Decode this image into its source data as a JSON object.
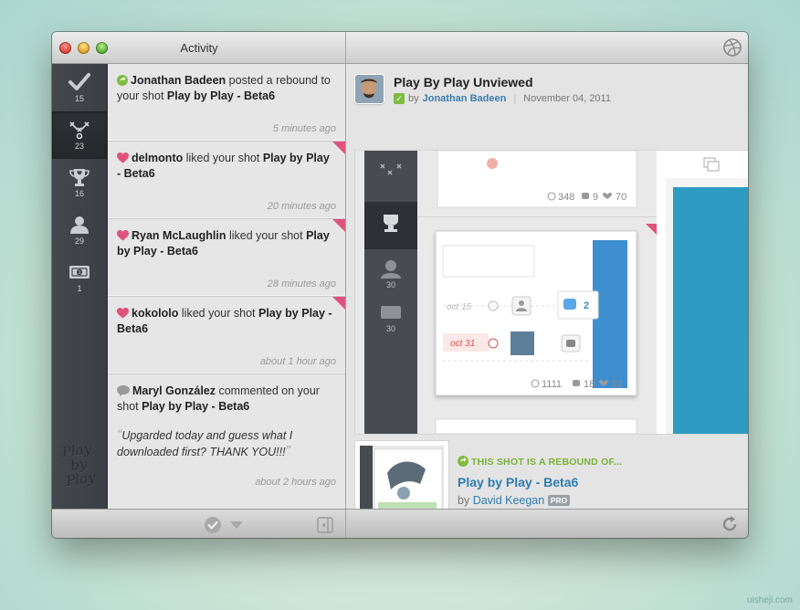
{
  "window": {
    "title": "Activity"
  },
  "sidebar": {
    "items": [
      {
        "icon": "checkmark-icon",
        "count": "15",
        "active": false
      },
      {
        "icon": "play-diagram-icon",
        "count": "23",
        "active": true
      },
      {
        "icon": "trophy-icon",
        "count": "16",
        "active": false
      },
      {
        "icon": "person-icon",
        "count": "29",
        "active": false
      },
      {
        "icon": "ticket-icon",
        "count": "1",
        "active": false
      }
    ],
    "logo_text": "Play by Play"
  },
  "activity": [
    {
      "kind": "rebound",
      "user": "Jonathan Badeen",
      "action": "posted a rebound to your shot",
      "shot": "Play by Play - Beta6",
      "time": "5 minutes ago",
      "flag": false
    },
    {
      "kind": "like",
      "user": "delmonto",
      "action": "liked your shot",
      "shot": "Play by Play - Beta6",
      "time": "20 minutes ago",
      "flag": true
    },
    {
      "kind": "like",
      "user": "Ryan McLaughlin",
      "action": "liked your shot",
      "shot": "Play by Play - Beta6",
      "time": "28 minutes ago",
      "flag": true
    },
    {
      "kind": "like",
      "user": "kokololo",
      "action": "liked your shot",
      "shot": "Play by Play - Beta6",
      "time": "about 1 hour ago",
      "flag": true
    },
    {
      "kind": "comment",
      "user": "Maryl González",
      "action": "commented on your shot",
      "shot": "Play by Play - Beta6",
      "quote": "Upgarded today and guess what I downloaded first? THANK YOU!!!",
      "time": "about 2 hours ago",
      "flag": false
    }
  ],
  "detail": {
    "title": "Play By Play Unviewed",
    "by_label": "by",
    "author": "Jonathan Badeen",
    "date": "November 04, 2011",
    "preview": {
      "top_stats": {
        "views": "348",
        "comments": "9",
        "likes": "70"
      },
      "bottom_stats": {
        "views": "1111",
        "comments": "18",
        "likes": "82"
      },
      "sidebar_counts": [
        "30",
        "30"
      ],
      "rows": [
        {
          "date": "oct 15",
          "badge": "2"
        },
        {
          "date": "oct 31"
        }
      ]
    },
    "rebound": {
      "label": "THIS SHOT IS A REBOUND OF...",
      "title": "Play by Play - Beta6",
      "by_label": "by",
      "author": "David Keegan",
      "badge": "PRO"
    }
  },
  "watermark": "uisheji.com"
}
